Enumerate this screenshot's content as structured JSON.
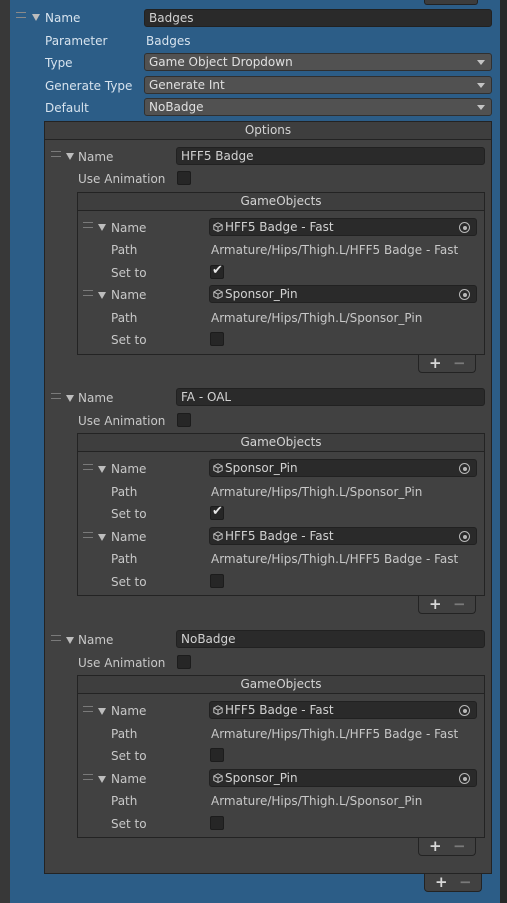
{
  "top": {
    "name_label": "Name",
    "name_value": "Badges",
    "parameter_label": "Parameter",
    "parameter_value": "Badges",
    "type_label": "Type",
    "type_value": "Game Object Dropdown",
    "generate_type_label": "Generate Type",
    "generate_type_value": "Generate Int",
    "default_label": "Default",
    "default_value": "NoBadge"
  },
  "options": {
    "header": "Options",
    "items": [
      {
        "name_label": "Name",
        "name_value": "HFF5 Badge",
        "use_animation_label": "Use Animation",
        "use_animation": false,
        "gameobjects_header": "GameObjects",
        "entries": [
          {
            "name_label": "Name",
            "object": "HFF5 Badge - Fast",
            "path_label": "Path",
            "path": "Armature/Hips/Thigh.L/HFF5 Badge - Fast",
            "setto_label": "Set to",
            "set_to": true
          },
          {
            "name_label": "Name",
            "object": "Sponsor_Pin",
            "path_label": "Path",
            "path": "Armature/Hips/Thigh.L/Sponsor_Pin",
            "setto_label": "Set to",
            "set_to": false
          }
        ]
      },
      {
        "name_label": "Name",
        "name_value": "FA - OAL",
        "use_animation_label": "Use Animation",
        "use_animation": false,
        "gameobjects_header": "GameObjects",
        "entries": [
          {
            "name_label": "Name",
            "object": "Sponsor_Pin",
            "path_label": "Path",
            "path": "Armature/Hips/Thigh.L/Sponsor_Pin",
            "setto_label": "Set to",
            "set_to": true
          },
          {
            "name_label": "Name",
            "object": "HFF5 Badge - Fast",
            "path_label": "Path",
            "path": "Armature/Hips/Thigh.L/HFF5 Badge - Fast",
            "setto_label": "Set to",
            "set_to": false
          }
        ]
      },
      {
        "name_label": "Name",
        "name_value": "NoBadge",
        "use_animation_label": "Use Animation",
        "use_animation": false,
        "gameobjects_header": "GameObjects",
        "entries": [
          {
            "name_label": "Name",
            "object": "HFF5 Badge - Fast",
            "path_label": "Path",
            "path": "Armature/Hips/Thigh.L/HFF5 Badge - Fast",
            "setto_label": "Set to",
            "set_to": false
          },
          {
            "name_label": "Name",
            "object": "Sponsor_Pin",
            "path_label": "Path",
            "path": "Armature/Hips/Thigh.L/Sponsor_Pin",
            "setto_label": "Set to",
            "set_to": false
          }
        ]
      }
    ]
  },
  "buttons": {
    "add": "+",
    "remove": "−"
  },
  "icons": {
    "object_icon": "cube-icon",
    "picker_icon": "object-picker-icon",
    "drag_icon": "drag-handle-icon",
    "foldout_icon": "foldout-arrow-icon"
  },
  "colors": {
    "selection_bg": "#2c5d87",
    "panel_bg": "#414141",
    "field_bg": "#2a2a2a"
  }
}
